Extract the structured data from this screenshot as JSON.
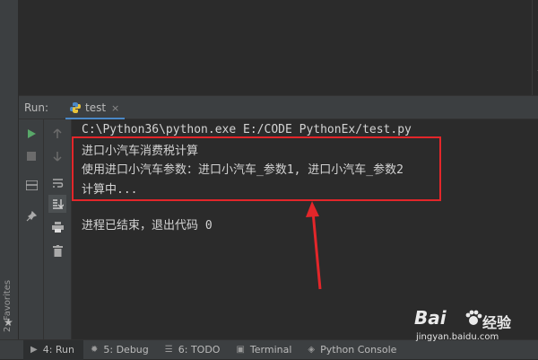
{
  "sidebar": {
    "favorites_label": "2: Favorites"
  },
  "run_panel": {
    "label": "Run:",
    "tab": {
      "label": "test",
      "close": "×"
    }
  },
  "console": {
    "lines": [
      "C:\\Python36\\python.exe E:/CODE PythonEx/test.py",
      "进口小汽车消费税计算",
      "使用进口小汽车参数：进口小汽车_参数1, 进口小汽车_参数2",
      "计算中...",
      "进程已结束，退出代码 0"
    ]
  },
  "bottom_tabs": [
    {
      "label": "4: Run",
      "icon": "run-icon"
    },
    {
      "label": "5: Debug",
      "icon": "bug-icon"
    },
    {
      "label": "6: TODO",
      "icon": "todo-icon"
    },
    {
      "label": "Terminal",
      "icon": "terminal-icon"
    },
    {
      "label": "Python Console",
      "icon": "python-icon"
    }
  ],
  "watermark": {
    "brand": "Bai",
    "cn": "经验",
    "url": "jingyan.baidu.com"
  },
  "colors": {
    "highlight_box": "#e3262a",
    "accent": "#4a88c7",
    "run_green": "#59a869"
  }
}
